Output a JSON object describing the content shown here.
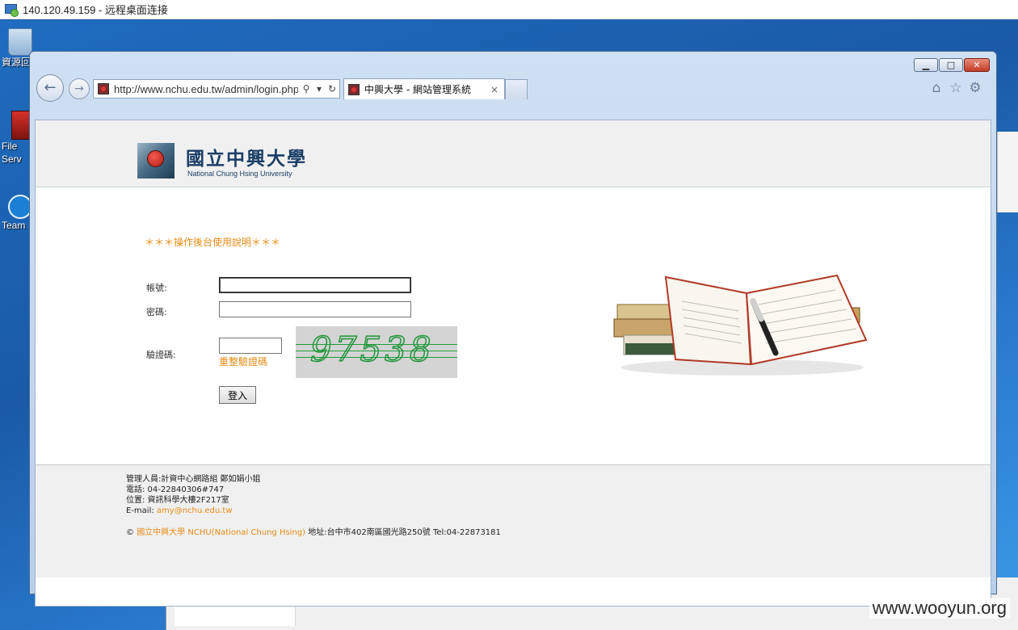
{
  "rdp": {
    "title": "140.120.49.159 - 远程桌面连接"
  },
  "desktop": {
    "icons": [
      {
        "label": "資源回"
      },
      {
        "label": "File Serv"
      },
      {
        "label": "Team"
      }
    ]
  },
  "browser": {
    "address": "http://www.nchu.edu.tw/admin/login.php",
    "tab_title": "中興大學 - 網站管理系統",
    "tab_close": "×",
    "win_minimize": "▁",
    "win_maximize": "□",
    "win_close": "✕",
    "back_glyph": "←",
    "forward_glyph": "→",
    "search_glyph": "⚲",
    "dropdown_glyph": "▾",
    "refresh_glyph": "↻",
    "home_glyph": "⌂",
    "favorites_glyph": "☆",
    "settings_glyph": "⚙"
  },
  "page": {
    "logo_cn": "國立中興大學",
    "logo_en": "National Chung Hsing University",
    "notice": "＊＊＊操作後台使用說明＊＊＊",
    "account_label": "帳號:",
    "password_label": "密碼:",
    "captcha_label": "驗證碼:",
    "account_value": "",
    "password_value": "",
    "captcha_value": "",
    "reset_captcha": "重整驗證碼",
    "captcha_image_text": "97538",
    "login_button": "登入"
  },
  "footer": {
    "admin": "管理人員:計資中心網路組 鄭如娟小姐",
    "phone": "電話: 04-22840306#747",
    "location": "位置: 資訊科學大樓2F217室",
    "email_label": "E-mail: ",
    "email": "amy@nchu.edu.tw",
    "copyright_symbol": "© ",
    "org": "國立中興大學 NCHU(National Chung Hsing)",
    "address": " 地址:台中市402南區國光路250號 Tel:04-22873181"
  },
  "watermark": "www.wooyun.org"
}
